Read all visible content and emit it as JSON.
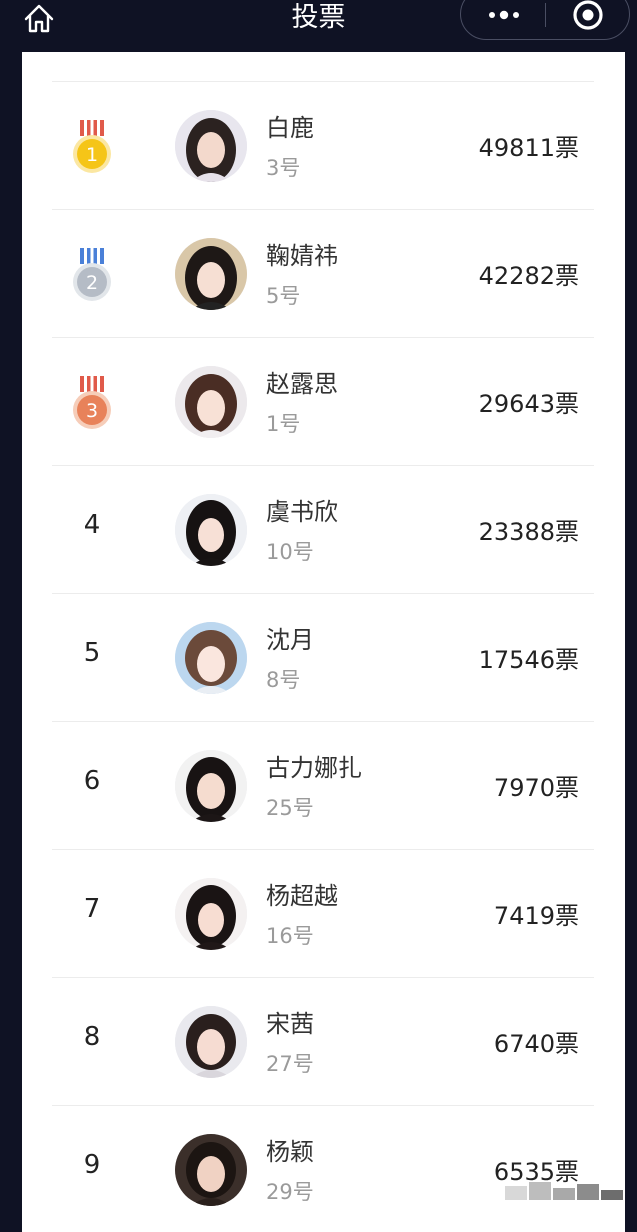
{
  "header": {
    "title": "投票",
    "home_icon": "home-icon",
    "more_icon": "more-dots-icon",
    "close_icon": "target-close-icon"
  },
  "colors": {
    "background": "#0f1224",
    "gold": "#f5c518",
    "silver": "#b5bcc6",
    "bronze": "#e8825a"
  },
  "ranking": [
    {
      "rank": "1",
      "name": "白鹿",
      "number": "3号",
      "votes": "49811票",
      "medal": "gold"
    },
    {
      "rank": "2",
      "name": "鞠婧祎",
      "number": "5号",
      "votes": "42282票",
      "medal": "silver"
    },
    {
      "rank": "3",
      "name": "赵露思",
      "number": "1号",
      "votes": "29643票",
      "medal": "bronze"
    },
    {
      "rank": "4",
      "name": "虞书欣",
      "number": "10号",
      "votes": "23388票"
    },
    {
      "rank": "5",
      "name": "沈月",
      "number": "8号",
      "votes": "17546票"
    },
    {
      "rank": "6",
      "name": "古力娜扎",
      "number": "25号",
      "votes": "7970票"
    },
    {
      "rank": "7",
      "name": "杨超越",
      "number": "16号",
      "votes": "7419票"
    },
    {
      "rank": "8",
      "name": "宋茜",
      "number": "27号",
      "votes": "6740票"
    },
    {
      "rank": "9",
      "name": "杨颖",
      "number": "29号",
      "votes": "6535票"
    }
  ]
}
